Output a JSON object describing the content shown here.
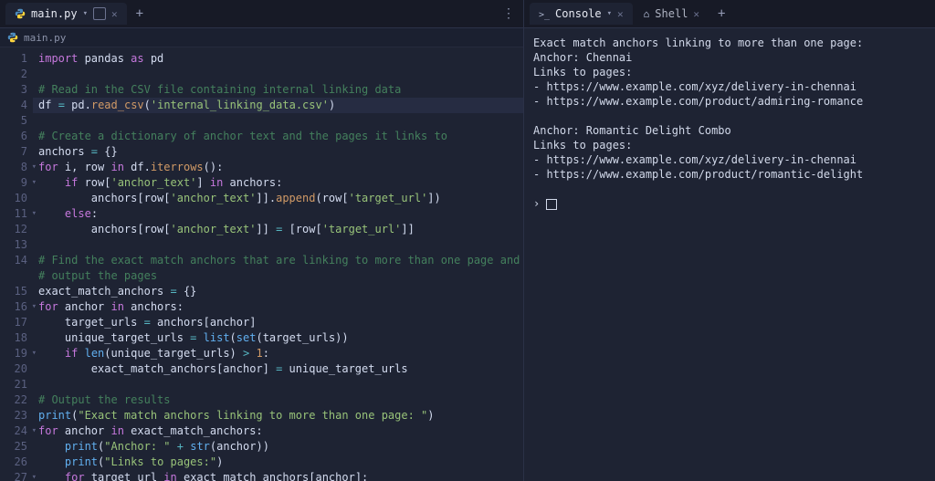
{
  "left": {
    "tabs": [
      {
        "label": "main.py",
        "active": true
      }
    ],
    "breadcrumb": "main.py",
    "lines": [
      {
        "n": 1,
        "fold": "",
        "hl": false,
        "tokens": [
          [
            "kw",
            "import"
          ],
          [
            "white",
            " pandas "
          ],
          [
            "kw",
            "as"
          ],
          [
            "white",
            " pd"
          ]
        ]
      },
      {
        "n": 2,
        "fold": "",
        "hl": false,
        "tokens": [
          [
            "",
            ""
          ]
        ]
      },
      {
        "n": 3,
        "fold": "",
        "hl": false,
        "tokens": [
          [
            "cmt",
            "# Read in the CSV file containing internal linking data"
          ]
        ]
      },
      {
        "n": 4,
        "fold": "",
        "hl": true,
        "tokens": [
          [
            "white",
            "df "
          ],
          [
            "eqp",
            "="
          ],
          [
            "white",
            " pd"
          ],
          [
            "white",
            "."
          ],
          [
            "attr",
            "read_csv"
          ],
          [
            "white",
            "("
          ],
          [
            "str",
            "'internal_linking_data.csv'"
          ],
          [
            "white",
            ")"
          ]
        ]
      },
      {
        "n": 5,
        "fold": "",
        "hl": false,
        "tokens": [
          [
            "",
            ""
          ]
        ]
      },
      {
        "n": 6,
        "fold": "",
        "hl": false,
        "tokens": [
          [
            "cmt",
            "# Create a dictionary of anchor text and the pages it links to"
          ]
        ]
      },
      {
        "n": 7,
        "fold": "",
        "hl": false,
        "tokens": [
          [
            "white",
            "anchors "
          ],
          [
            "eqp",
            "="
          ],
          [
            "white",
            " {}"
          ]
        ]
      },
      {
        "n": 8,
        "fold": "▾",
        "hl": false,
        "tokens": [
          [
            "kw",
            "for"
          ],
          [
            "white",
            " i, row "
          ],
          [
            "kw",
            "in"
          ],
          [
            "white",
            " df."
          ],
          [
            "attr",
            "iterrows"
          ],
          [
            "white",
            "():"
          ]
        ]
      },
      {
        "n": 9,
        "fold": "▾",
        "hl": false,
        "tokens": [
          [
            "white",
            "    "
          ],
          [
            "kw",
            "if"
          ],
          [
            "white",
            " row["
          ],
          [
            "str",
            "'anchor_text'"
          ],
          [
            "white",
            "] "
          ],
          [
            "kw",
            "in"
          ],
          [
            "white",
            " anchors:"
          ]
        ]
      },
      {
        "n": 10,
        "fold": "",
        "hl": false,
        "tokens": [
          [
            "white",
            "        anchors[row["
          ],
          [
            "str",
            "'anchor_text'"
          ],
          [
            "white",
            "]]."
          ],
          [
            "attr",
            "append"
          ],
          [
            "white",
            "(row["
          ],
          [
            "str",
            "'target_url'"
          ],
          [
            "white",
            "])"
          ]
        ]
      },
      {
        "n": 11,
        "fold": "▾",
        "hl": false,
        "tokens": [
          [
            "white",
            "    "
          ],
          [
            "kw",
            "else"
          ],
          [
            "white",
            ":"
          ]
        ]
      },
      {
        "n": 12,
        "fold": "",
        "hl": false,
        "tokens": [
          [
            "white",
            "        anchors[row["
          ],
          [
            "str",
            "'anchor_text'"
          ],
          [
            "white",
            "]] "
          ],
          [
            "eqp",
            "="
          ],
          [
            "white",
            " [row["
          ],
          [
            "str",
            "'target_url'"
          ],
          [
            "white",
            "]]"
          ]
        ]
      },
      {
        "n": 13,
        "fold": "",
        "hl": false,
        "tokens": [
          [
            "",
            ""
          ]
        ]
      },
      {
        "n": 14,
        "fold": "",
        "hl": false,
        "tokens": [
          [
            "cmt",
            "# Find the exact match anchors that are linking to more than one page and\\n# output the pages"
          ]
        ]
      },
      {
        "n": 15,
        "fold": "",
        "hl": false,
        "tokens": [
          [
            "white",
            "exact_match_anchors "
          ],
          [
            "eqp",
            "="
          ],
          [
            "white",
            " {}"
          ]
        ]
      },
      {
        "n": 16,
        "fold": "▾",
        "hl": false,
        "tokens": [
          [
            "kw",
            "for"
          ],
          [
            "white",
            " anchor "
          ],
          [
            "kw",
            "in"
          ],
          [
            "white",
            " anchors:"
          ]
        ]
      },
      {
        "n": 17,
        "fold": "",
        "hl": false,
        "tokens": [
          [
            "white",
            "    target_urls "
          ],
          [
            "eqp",
            "="
          ],
          [
            "white",
            " anchors[anchor]"
          ]
        ]
      },
      {
        "n": 18,
        "fold": "",
        "hl": false,
        "tokens": [
          [
            "white",
            "    unique_target_urls "
          ],
          [
            "eqp",
            "="
          ],
          [
            "white",
            " "
          ],
          [
            "fn",
            "list"
          ],
          [
            "white",
            "("
          ],
          [
            "fn",
            "set"
          ],
          [
            "white",
            "(target_urls))"
          ]
        ]
      },
      {
        "n": 19,
        "fold": "▾",
        "hl": false,
        "tokens": [
          [
            "white",
            "    "
          ],
          [
            "kw",
            "if"
          ],
          [
            "white",
            " "
          ],
          [
            "fn",
            "len"
          ],
          [
            "white",
            "(unique_target_urls) "
          ],
          [
            "eqp",
            ">"
          ],
          [
            "white",
            " "
          ],
          [
            "num",
            "1"
          ],
          [
            "white",
            ":"
          ]
        ]
      },
      {
        "n": 20,
        "fold": "",
        "hl": false,
        "tokens": [
          [
            "white",
            "        exact_match_anchors[anchor] "
          ],
          [
            "eqp",
            "="
          ],
          [
            "white",
            " unique_target_urls"
          ]
        ]
      },
      {
        "n": 21,
        "fold": "",
        "hl": false,
        "tokens": [
          [
            "",
            ""
          ]
        ]
      },
      {
        "n": 22,
        "fold": "",
        "hl": false,
        "tokens": [
          [
            "cmt",
            "# Output the results"
          ]
        ]
      },
      {
        "n": 23,
        "fold": "",
        "hl": false,
        "tokens": [
          [
            "fn",
            "print"
          ],
          [
            "white",
            "("
          ],
          [
            "str",
            "\"Exact match anchors linking to more than one page: \""
          ],
          [
            "white",
            ")"
          ]
        ]
      },
      {
        "n": 24,
        "fold": "▾",
        "hl": false,
        "tokens": [
          [
            "kw",
            "for"
          ],
          [
            "white",
            " anchor "
          ],
          [
            "kw",
            "in"
          ],
          [
            "white",
            " exact_match_anchors:"
          ]
        ]
      },
      {
        "n": 25,
        "fold": "",
        "hl": false,
        "tokens": [
          [
            "white",
            "    "
          ],
          [
            "fn",
            "print"
          ],
          [
            "white",
            "("
          ],
          [
            "str",
            "\"Anchor: \""
          ],
          [
            "white",
            " "
          ],
          [
            "eqp",
            "+"
          ],
          [
            "white",
            " "
          ],
          [
            "fn",
            "str"
          ],
          [
            "white",
            "(anchor))"
          ]
        ]
      },
      {
        "n": 26,
        "fold": "",
        "hl": false,
        "tokens": [
          [
            "white",
            "    "
          ],
          [
            "fn",
            "print"
          ],
          [
            "white",
            "("
          ],
          [
            "str",
            "\"Links to pages:\""
          ],
          [
            "white",
            ")"
          ]
        ]
      },
      {
        "n": 27,
        "fold": "▾",
        "hl": false,
        "tokens": [
          [
            "white",
            "    "
          ],
          [
            "kw",
            "for"
          ],
          [
            "white",
            " target_url "
          ],
          [
            "kw",
            "in"
          ],
          [
            "white",
            " exact_match_anchors[anchor]:"
          ]
        ]
      }
    ]
  },
  "right": {
    "tabs": [
      {
        "label": "Console",
        "active": true
      },
      {
        "label": "Shell",
        "active": false
      }
    ],
    "output": "Exact match anchors linking to more than one page:\nAnchor: Chennai\nLinks to pages:\n- https://www.example.com/xyz/delivery-in-chennai\n- https://www.example.com/product/admiring-romance\n\nAnchor: Romantic Delight Combo\nLinks to pages:\n- https://www.example.com/xyz/delivery-in-chennai\n- https://www.example.com/product/romantic-delight",
    "prompt_prefix": "› "
  }
}
